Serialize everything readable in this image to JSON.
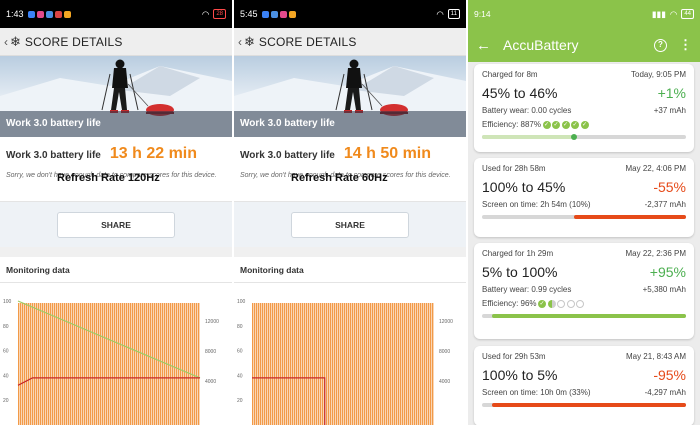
{
  "left": {
    "status": {
      "time": "1:43",
      "battery": "28"
    },
    "appbar": {
      "back": "‹",
      "title": "SCORE DETAILS"
    },
    "hero_caption": "Work 3.0 battery life",
    "score_label": "Work 3.0 battery life",
    "score_value": "13 h 22 min",
    "note": "Sorry, we don't have enough data to compare scores for this device.",
    "overlay_text": "Refresh Rate 120Hz",
    "share": "SHARE",
    "monitoring": "Monitoring data",
    "chart": {
      "left_ticks": [
        "100",
        "80",
        "60",
        "40",
        "20"
      ],
      "right_ticks": [
        "12000",
        "8000",
        "4000"
      ],
      "battery_line": {
        "x": [
          0,
          1
        ],
        "y": [
          100,
          38
        ]
      },
      "temp_line": {
        "x": [
          0,
          0.08,
          1
        ],
        "y": [
          32,
          38,
          38
        ]
      }
    }
  },
  "middle": {
    "status": {
      "time": "5:45",
      "battery": "11"
    },
    "appbar": {
      "back": "‹",
      "title": "SCORE DETAILS"
    },
    "hero_caption": "Work 3.0 battery life",
    "score_label": "Work 3.0 battery life",
    "score_value": "14 h 50 min",
    "note": "Sorry, we don't have enough data to compare scores for this device.",
    "overlay_text": "Refresh Rate 60Hz",
    "share": "SHARE",
    "monitoring": "Monitoring data",
    "chart": {
      "left_ticks": [
        "100",
        "80",
        "60",
        "40",
        "20"
      ],
      "right_ticks": [
        "12000",
        "8000",
        "4000"
      ],
      "temp_line": {
        "x": [
          0,
          0.4,
          0.4
        ],
        "y": [
          38,
          38,
          0
        ]
      }
    }
  },
  "right": {
    "status": {
      "time": "9:14",
      "battery": "44"
    },
    "appbar": {
      "title": "AccuBattery",
      "help": "?",
      "more": "⋮",
      "back": "←"
    },
    "cards": [
      {
        "top_left": "Charged for 8m",
        "top_right": "Today, 9:05 PM",
        "range": "45% to 46%",
        "pct": "+1%",
        "kind": "pos",
        "info_left": "Battery wear: 0.00 cycles",
        "info_right": "+37 mAh",
        "eff_label": "Efficiency: 887%",
        "eff_dots": [
          "full",
          "full",
          "full",
          "full",
          "full"
        ],
        "bar_start": 0,
        "bar_end": 0.45,
        "bar_color": "#cfe5b8",
        "marker": 0.45
      },
      {
        "top_left": "Used for 28h 58m",
        "top_right": "May 22, 4:06 PM",
        "range": "100% to 45%",
        "pct": "-55%",
        "kind": "neg",
        "info_left": "Screen on time: 2h 54m (10%)",
        "info_right": "-2,377 mAh",
        "bar_start": 0.45,
        "bar_end": 1,
        "bar_color": "#e64a19"
      },
      {
        "top_left": "Charged for 1h 29m",
        "top_right": "May 22, 2:36 PM",
        "range": "5% to 100%",
        "pct": "+95%",
        "kind": "pos",
        "info_left": "Battery wear: 0.99 cycles",
        "info_right": "+5,380 mAh",
        "eff_label": "Efficiency: 96%",
        "eff_dots": [
          "full",
          "half",
          "empty",
          "empty",
          "empty"
        ],
        "bar_start": 0.05,
        "bar_end": 1,
        "bar_color": "#8bc34a"
      },
      {
        "top_left": "Used for 29h 53m",
        "top_right": "May 21, 8:43 AM",
        "range": "100% to 5%",
        "pct": "-95%",
        "kind": "neg",
        "info_left": "Screen on time: 10h 0m (33%)",
        "info_right": "-4,297 mAh",
        "bar_start": 0.05,
        "bar_end": 1,
        "bar_color": "#e64a19"
      }
    ]
  }
}
